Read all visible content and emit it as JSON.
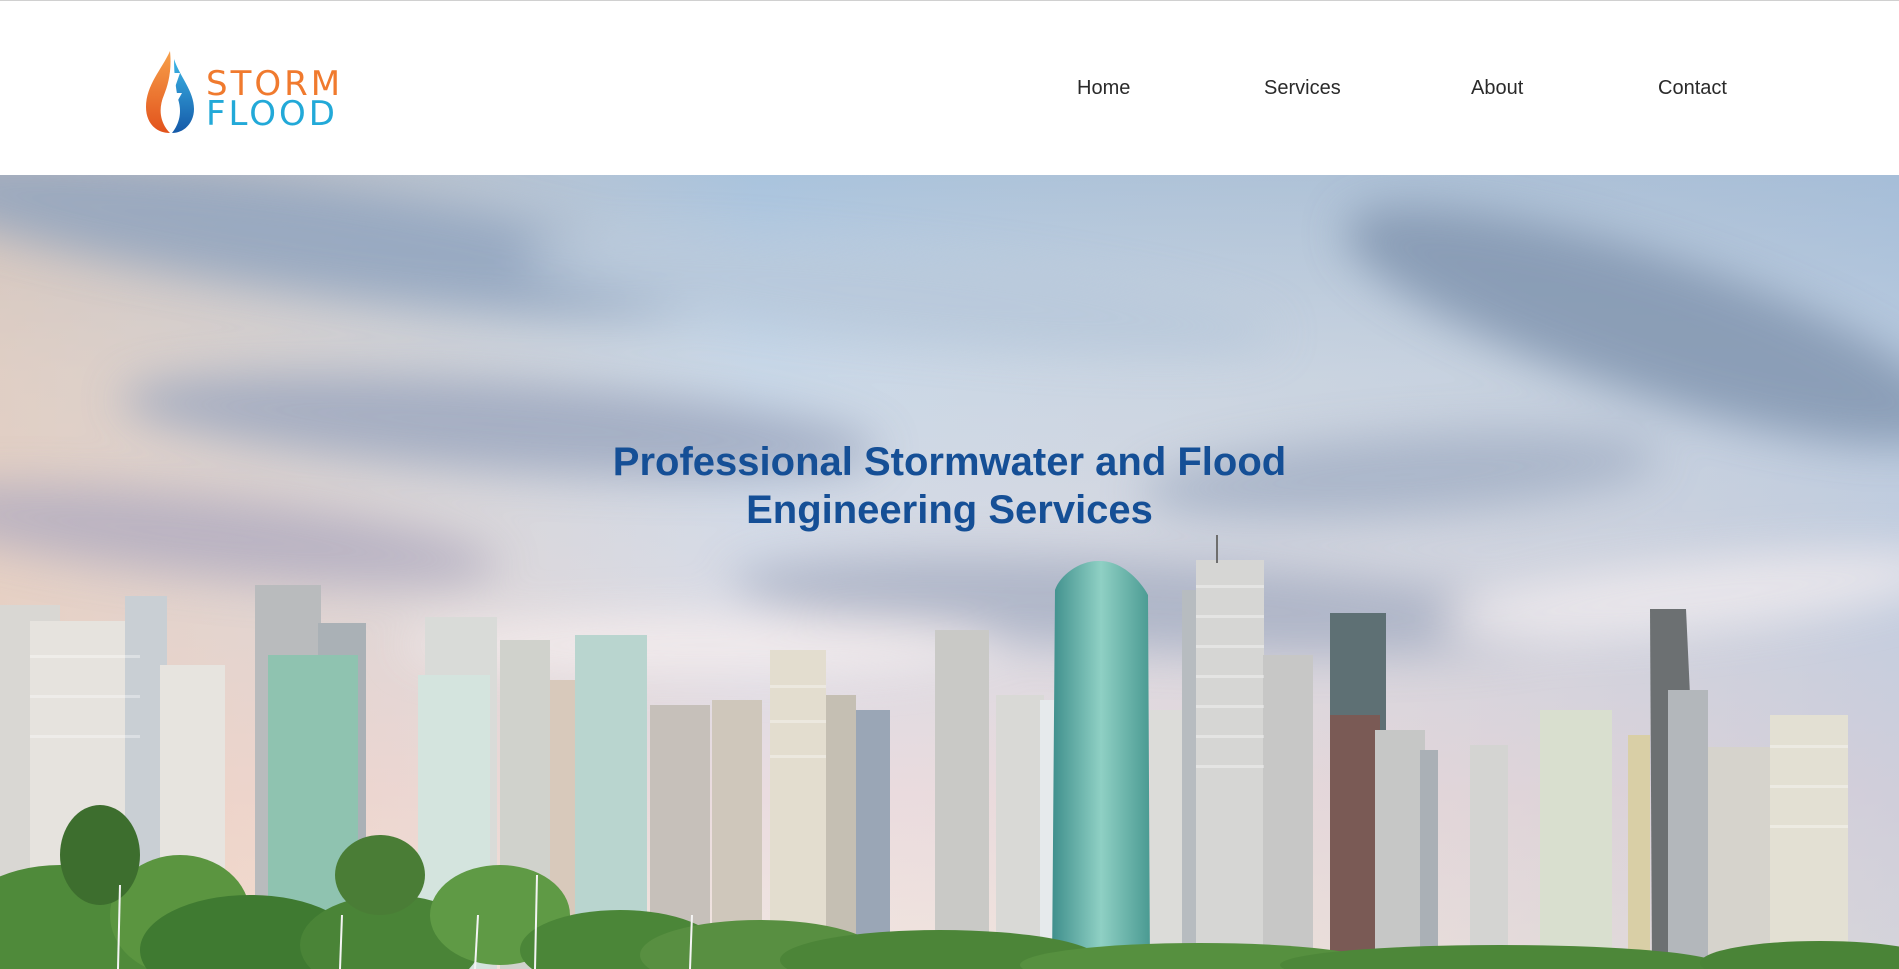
{
  "logo": {
    "line1": "STORM",
    "line2": "FLOOD"
  },
  "nav": {
    "items": [
      {
        "label": "Home"
      },
      {
        "label": "Services"
      },
      {
        "label": "About"
      },
      {
        "label": "Contact"
      }
    ]
  },
  "hero": {
    "title_line1": "Professional Stormwater and Flood",
    "title_line2": "Engineering Services"
  },
  "colors": {
    "brand_orange": "#f07a2e",
    "brand_blue": "#22a9d8",
    "title_blue": "#154f96",
    "nav_text": "#2a2a2a"
  },
  "icons": {
    "logo_mark": "flame-droplet-lightning-icon"
  }
}
